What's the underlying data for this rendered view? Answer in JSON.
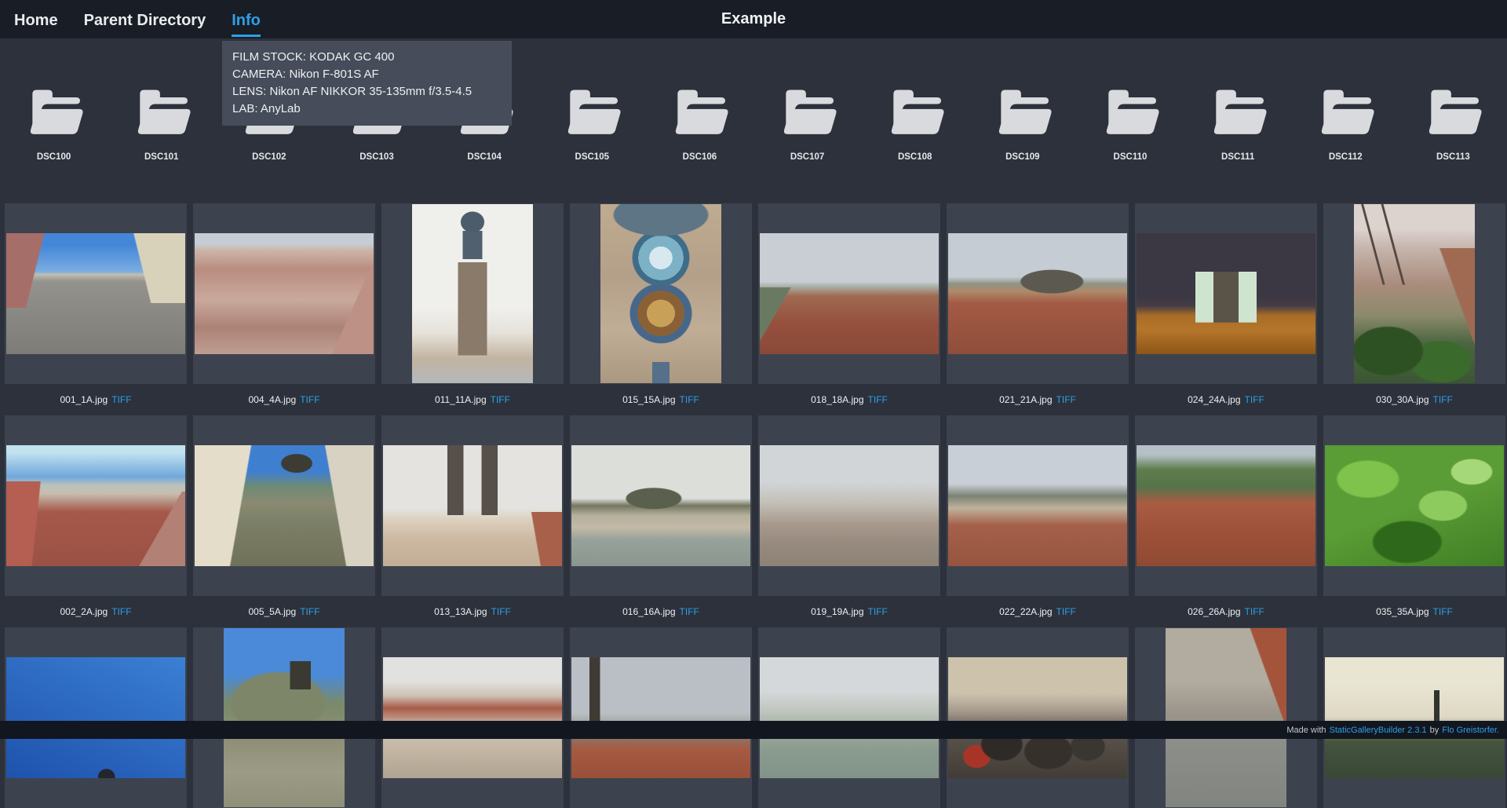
{
  "nav": {
    "items": [
      {
        "label": "Home"
      },
      {
        "label": "Parent Directory"
      },
      {
        "label": "Info",
        "active": true
      }
    ],
    "title": "Example"
  },
  "tooltip": {
    "lines": [
      "FILM STOCK: KODAK GC 400",
      "CAMERA: Nikon F-801S AF",
      "LENS: Nikon AF NIKKOR 35-135mm f/3.5-4.5",
      "LAB: AnyLab"
    ]
  },
  "folders": [
    "DSC100",
    "DSC101",
    "DSC102",
    "DSC103",
    "DSC104",
    "DSC105",
    "DSC106",
    "DSC107",
    "DSC108",
    "DSC109",
    "DSC110",
    "DSC111",
    "DSC112",
    "DSC113"
  ],
  "gallery": {
    "tiff_label": "TIFF",
    "rows": [
      [
        {
          "file": "001_1A.jpg",
          "shape": "landscape",
          "scene": "street"
        },
        {
          "file": "004_4A.jpg",
          "shape": "landscape",
          "scene": "rooftops"
        },
        {
          "file": "011_11A.jpg",
          "shape": "portrait",
          "scene": "townhall"
        },
        {
          "file": "015_15A.jpg",
          "shape": "portrait",
          "scene": "clock"
        },
        {
          "file": "018_18A.jpg",
          "shape": "landscape",
          "scene": "panorama"
        },
        {
          "file": "021_21A.jpg",
          "shape": "landscape",
          "scene": "castle-pan"
        },
        {
          "file": "024_24A.jpg",
          "shape": "landscape",
          "scene": "night"
        },
        {
          "file": "030_30A.jpg",
          "shape": "portrait",
          "scene": "tree-city"
        }
      ],
      [
        {
          "file": "002_2A.jpg",
          "shape": "landscape",
          "scene": "sky-rooftops"
        },
        {
          "file": "005_5A.jpg",
          "shape": "landscape",
          "scene": "hill-town"
        },
        {
          "file": "013_13A.jpg",
          "shape": "landscape",
          "scene": "twin-spires"
        },
        {
          "file": "016_16A.jpg",
          "shape": "landscape",
          "scene": "river-castle"
        },
        {
          "file": "019_19A.jpg",
          "shape": "landscape",
          "scene": "hazy"
        },
        {
          "file": "022_22A.jpg",
          "shape": "landscape",
          "scene": "city-roofs"
        },
        {
          "file": "026_26A.jpg",
          "shape": "landscape",
          "scene": "green-hill"
        },
        {
          "file": "035_35A.jpg",
          "shape": "landscape",
          "scene": "foliage"
        }
      ],
      [
        {
          "shape": "landscape",
          "scene": "blue-sky"
        },
        {
          "shape": "portrait",
          "scene": "hill-tower"
        },
        {
          "shape": "landscape",
          "scene": "facades"
        },
        {
          "shape": "landscape",
          "scene": "statue-skyline"
        },
        {
          "shape": "landscape",
          "scene": "misty-city"
        },
        {
          "shape": "landscape",
          "scene": "crowd"
        },
        {
          "shape": "portrait",
          "scene": "aerial-street"
        },
        {
          "shape": "landscape",
          "scene": "treeline"
        }
      ]
    ]
  },
  "footer": {
    "prefix": "Made with",
    "link_builder": "StaticGalleryBuilder 2.3.1",
    "mid": "by",
    "link_author": "Flo Greistorfer."
  },
  "colors": {
    "accent": "#2e9fe8",
    "header_bg": "#191d26",
    "page_bg": "#2c313b",
    "tile_bg": "#3d434e",
    "tooltip_bg": "#464c59",
    "footer_bg": "#12161f",
    "folder_icon": "#d8dade"
  }
}
